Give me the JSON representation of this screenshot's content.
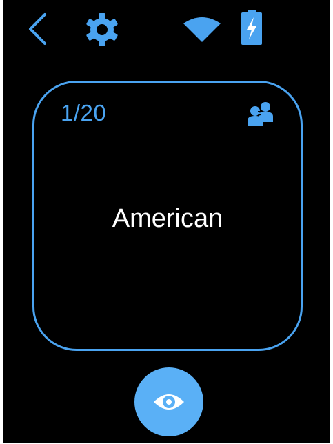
{
  "colors": {
    "background": "#000000",
    "accent": "#4aa3f0",
    "button": "#5ab0f6",
    "text": "#ffffff"
  },
  "status_bar": {
    "icons": [
      "back-arrow-icon",
      "gear-icon",
      "wifi-icon",
      "battery-charging-icon"
    ]
  },
  "card": {
    "counter": "1/20",
    "word": "American",
    "mode_icon": "people-icon"
  },
  "reveal_button": {
    "icon": "eye-icon"
  }
}
